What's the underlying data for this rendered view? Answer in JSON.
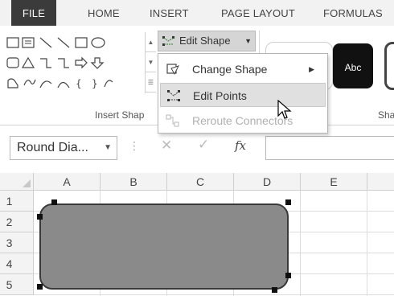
{
  "ribbon": {
    "tabs": [
      "FILE",
      "HOME",
      "INSERT",
      "PAGE LAYOUT",
      "FORMULAS"
    ],
    "edit_shape_label": "Edit Shape",
    "insert_shapes_group": "Insert Shap",
    "shape_styles_group": "Sha",
    "style_preview_text": "Abc"
  },
  "menu": {
    "items": [
      {
        "label": "Change Shape",
        "icon": "change-shape-icon",
        "submenu": true,
        "state": "normal"
      },
      {
        "label": "Edit Points",
        "icon": "edit-points-icon",
        "submenu": false,
        "state": "highlighted"
      },
      {
        "label": "Reroute Connectors",
        "icon": "reroute-connectors-icon",
        "submenu": false,
        "state": "disabled"
      }
    ]
  },
  "formula_bar": {
    "name_box": "Round Dia...",
    "fx_label": "fx",
    "formula": ""
  },
  "sheet": {
    "columns": [
      "A",
      "B",
      "C",
      "D",
      "E"
    ],
    "rows": [
      "1",
      "2",
      "3",
      "4",
      "5"
    ]
  },
  "colors": {
    "file_tab": "#3b3b3b",
    "shape_fill": "#8a8a8a",
    "menu_highlight": "#e0e0e0"
  }
}
